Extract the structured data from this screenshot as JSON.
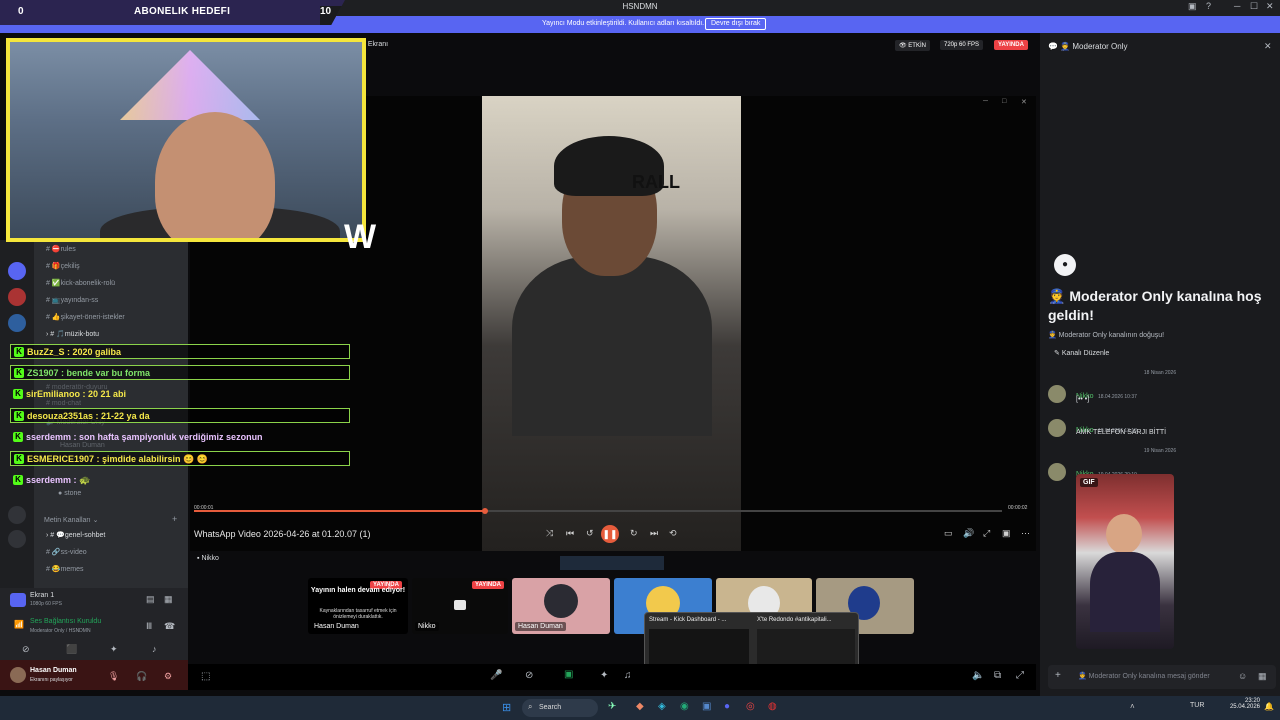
{
  "window": {
    "title": "HSNDMN",
    "notice_text": "Yayıncı Modu etkinleştirildi. Kullanıcı adları kısaltıldı.",
    "notice_button": "Devre dışı bırak"
  },
  "goal": {
    "left_value": "0",
    "title": "ABONELIK HEDEFI",
    "target": "10"
  },
  "channels": {
    "items": [
      "rules",
      "çekiliş",
      "kick-abonelik-rolü",
      "yayından-ss",
      "şikayet-öneri-istekler",
      "müzik-botu",
      "moderatör-duyuru",
      "mod-chat",
      "Moderator Only"
    ],
    "voice_names": [
      "Hasan Duman",
      "stone"
    ],
    "text_category": "Metin Kanalları",
    "text_items": [
      "genel-sohbet",
      "ss-video",
      "memes"
    ],
    "screen_label": "Ekran 1",
    "screen_sub": "1080p 60 FPS",
    "voice_status": "Ses Bağlantısı Kuruldu",
    "voice_channel": "Moderator Only / HSNDMN",
    "user_name": "Hasan Duman",
    "user_status": "Ekranını paylaşıyor"
  },
  "chat": [
    {
      "text": "BuzZz_S : 2020 galiba",
      "color": "#f5e84a",
      "box": true
    },
    {
      "text": "ZS1907 : bende var bu forma",
      "color": "#7fe36a",
      "box": true
    },
    {
      "text": "sirEmilianoo : 20 21 abi",
      "color": "#f5e84a",
      "box": false
    },
    {
      "text": "desouza2351as : 21-22 ya da",
      "color": "#f5e84a",
      "box": true
    },
    {
      "text": "sserdemm : son hafta şampiyonluk verdiğimiz sezonun",
      "color": "#e9c3ff",
      "box": false
    },
    {
      "text": "ESMERICE1907 : şimdide alabilirsin 😊 😊",
      "color": "#f5e84a",
      "box": true
    },
    {
      "text": "sserdemm : 🐢",
      "color": "#e9c3ff",
      "box": false
    }
  ],
  "stream": {
    "screen_label": "n Ekranı",
    "status_active": "ETKİN",
    "quality": "720p 60 FPS",
    "live": "YAYINDA",
    "video_title": "WhatsApp Video 2026-04-26 at 01.20.07 (1)",
    "time_current": "00:00:01",
    "time_total": "00:00:02",
    "progress": 0.36,
    "viewer": "Nikko",
    "video_letters": "RALL"
  },
  "tiles": {
    "paused_title": "Yayının halen devam ediyor!",
    "paused_sub": "Kaynaklarından tasarruf etmek için önizlemeyi duraklattık.",
    "paused_name": "Hasan Duman",
    "nikko": "Nikko",
    "hasan": "Hasan Duman",
    "live": "YAYINDA"
  },
  "thumbs": [
    {
      "label": "Stream - Kick Dashboard - ..."
    },
    {
      "label": "X'te Redondo #antikapitali..."
    }
  ],
  "right": {
    "header": "Moderator Only",
    "welcome": "Moderator Only kanalına hoş geldin!",
    "sub": "Moderator Only kanalının doğuşu!",
    "edit": "Kanalı Düzenle",
    "date1": "18 Nisan 2026",
    "date2": "19 Nisan 2026",
    "messages": [
      {
        "name": "Nikko",
        "time": "18.04.2026 10:37",
        "text": "[•• •]"
      },
      {
        "name": "Nikko",
        "time": "18.04.2026 13:18",
        "text": "AMK TELEFON SARJI BİTTİ"
      },
      {
        "name": "Nikko",
        "time": "19.04.2026 20:19",
        "text": ""
      }
    ],
    "gif": "GIF",
    "input_placeholder": "Moderator Only kanalına mesaj gönder"
  },
  "taskbar": {
    "search": "Search",
    "lang": "TUR",
    "time": "23:20",
    "date": "25.04.2026"
  },
  "colors": {
    "accent": "#5865f2",
    "kick": "#53fc18",
    "webcam_border": "#f5e63c",
    "live": "#ed4245"
  }
}
